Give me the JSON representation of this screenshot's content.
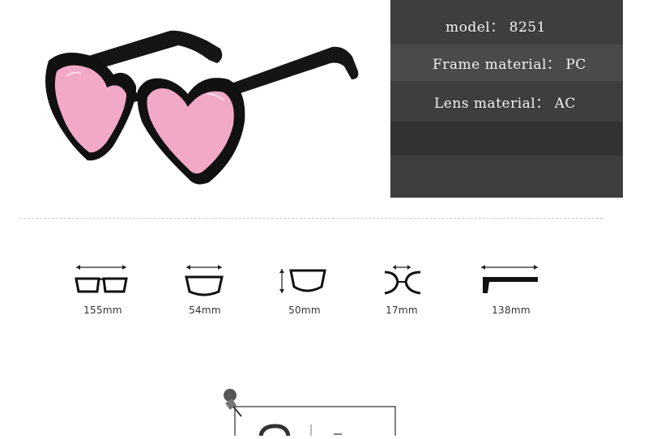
{
  "spec": {
    "model_label": "model： 8251",
    "frame_label": "Frame material： PC",
    "lens_label": "Lens material： AC"
  },
  "measurements": [
    {
      "label": "155mm",
      "icon": "frame-width-icon"
    },
    {
      "label": "54mm",
      "icon": "lens-width-icon"
    },
    {
      "label": "50mm",
      "icon": "lens-height-icon"
    },
    {
      "label": "17mm",
      "icon": "bridge-width-icon"
    },
    {
      "label": "138mm",
      "icon": "temple-length-icon"
    }
  ],
  "colors": {
    "panel": "#3e3e3e",
    "frame": "#111111",
    "lens": "#f2a9c8"
  }
}
